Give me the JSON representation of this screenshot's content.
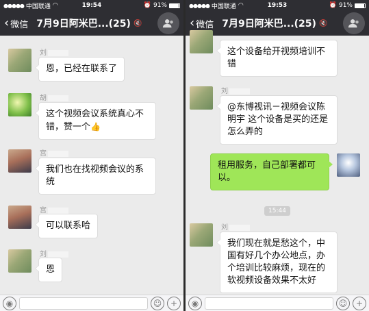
{
  "status": {
    "carrier": "中国联通",
    "left_time": "19:54",
    "right_time": "19:53",
    "battery": "91%"
  },
  "nav": {
    "back_label": "微信",
    "title": "7月9日阿米巴...(25)"
  },
  "left_chat": [
    {
      "sender": "刘",
      "text": "恩，已经在联系了"
    },
    {
      "sender": "胡",
      "text": "这个视频会议系统真心不错，赞一个"
    },
    {
      "sender": "宫",
      "text": "我们也在找视频会议的系统"
    },
    {
      "sender": "宫",
      "text": "可以联系哈"
    },
    {
      "sender": "刘",
      "text": "恩"
    }
  ],
  "right_chat": {
    "msg1": {
      "text": "这个设备给开视频培训不错"
    },
    "msg2": {
      "sender": "刘",
      "text": "@东博视讯－视频会议陈明宇 这个设备是买的还是怎么弄的"
    },
    "msg3": {
      "text": "租用服务，自己部署都可以。"
    },
    "timestamp": "15:44",
    "msg4": {
      "sender": "刘",
      "text": "我们现在就是愁这个，中国有好几个办公地点，办个培训比较麻烦，现在的软视频设备效果不太好"
    }
  },
  "icons": {
    "voice": "voice-icon",
    "emoji": "emoji-icon",
    "plus": "plus-icon",
    "thumbs_up": "thumbs-up-icon",
    "group_info": "group-info-icon",
    "mute": "mute-icon"
  },
  "colors": {
    "navbar": "#2e2e33",
    "chat_bg": "#ebebeb",
    "outgoing_bubble": "#9fe658",
    "incoming_bubble": "#ffffff"
  }
}
